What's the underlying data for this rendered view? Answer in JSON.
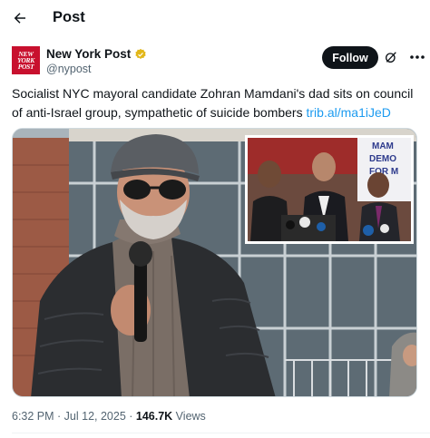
{
  "header": {
    "title": "Post",
    "back_icon": "arrow-left-icon"
  },
  "author": {
    "name": "New York Post",
    "handle": "@nypost",
    "logo_text": [
      "NEW",
      "YORK",
      "POST"
    ],
    "verified_icon": "gold-verified-badge-icon",
    "follow_label": "Follow",
    "grok_icon": "grok-icon",
    "more_icon": "more-dots-icon"
  },
  "tweet": {
    "text": "Socialist NYC mayoral candidate Zohran Mamdani's dad sits on council of anti-Israel group, sympathetic of suicide bombers ",
    "link": "trib.al/ma1iJeD"
  },
  "media": {
    "inset_sign": [
      "MAM",
      "DEMO",
      "FOR M"
    ]
  },
  "meta": {
    "time": "6:32 PM · Jul 12, 2025 · ",
    "views_count": "146.7K",
    "views_label": " Views"
  },
  "colors": {
    "brand_red": "#c8102e",
    "link_blue": "#1d9bf0",
    "verified_gold": "#e2b719",
    "follow_bg": "#0f1419"
  }
}
